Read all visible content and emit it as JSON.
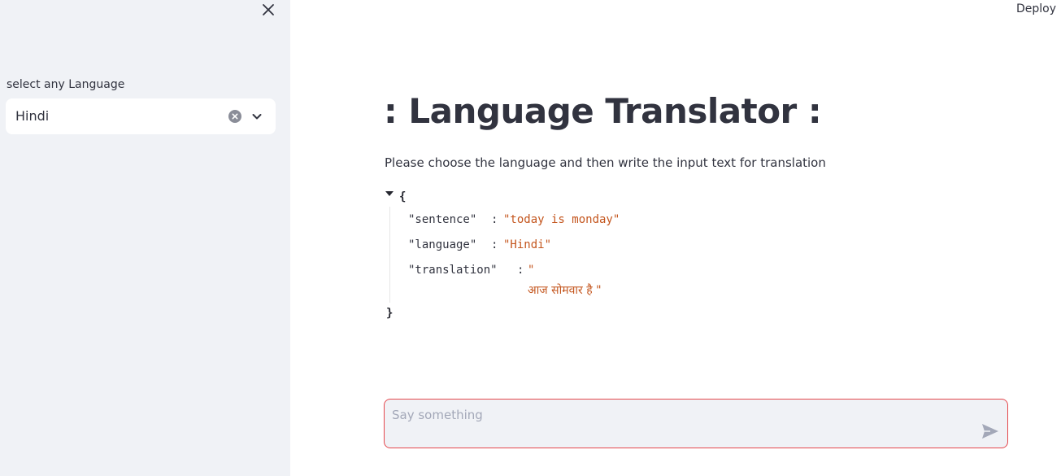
{
  "header": {
    "deploy_label": "Deploy"
  },
  "sidebar": {
    "close_icon": "close-icon",
    "select_label": "select any Language",
    "select_value": "Hindi",
    "clear_icon": "clear-circle-icon",
    "chevron_icon": "chevron-down-icon"
  },
  "main": {
    "title": ": Language Translator :",
    "subtitle": "Please choose the language and then write the input text for translation",
    "json": {
      "open_brace": "{",
      "close_brace": "}",
      "entries": [
        {
          "key": "\"sentence\"",
          "colon": ":",
          "value": "\"today is monday\""
        },
        {
          "key": "\"language\"",
          "colon": ":",
          "value": "\"Hindi\""
        },
        {
          "key": "\"translation\"",
          "colon": ":",
          "value_line1": "\"",
          "value_line2": "आज सोमवार है \""
        }
      ]
    }
  },
  "chat": {
    "placeholder": "Say something",
    "send_icon": "send-icon"
  },
  "colors": {
    "sidebar_bg": "#f0f2f6",
    "text": "#31333f",
    "json_value": "#c4561e",
    "input_border_focus": "#e5484d"
  }
}
